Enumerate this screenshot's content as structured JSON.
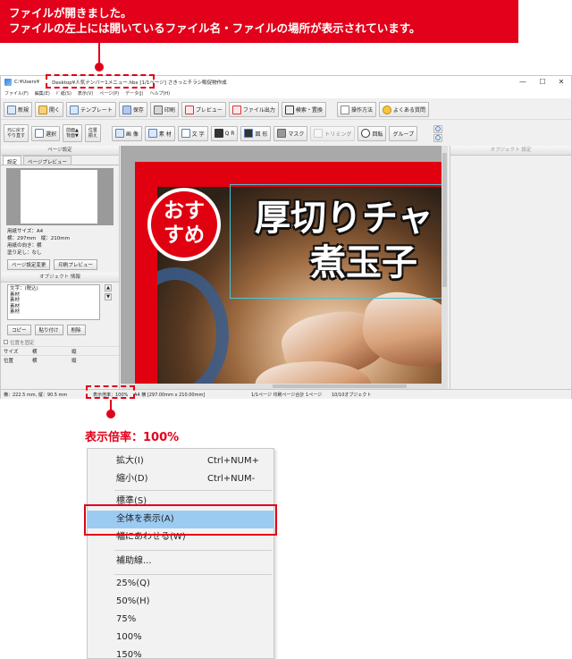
{
  "callout": {
    "line1": "ファイルが開きました。",
    "line2": "ファイルの左上には開いているファイル名・ファイルの場所が表示されています。"
  },
  "window": {
    "title_path": "C:¥Users¥",
    "title_file": "Desktop¥人気ナンバー1メニュー.hbs",
    "title_page": "[1/1ページ]",
    "title_app": "さきっとチラシ販促物作成",
    "minimize": "—",
    "maximize": "☐",
    "close": "✕"
  },
  "menubar": [
    "ファイル(F)",
    "編集(E)",
    "ﾄﾞ紙(S)",
    "表示(V)",
    "ページ(P)",
    "データ(J)",
    "ヘルプ(H)"
  ],
  "toolbar1": {
    "new": "新規",
    "open": "開く",
    "template": "テンプレート",
    "save": "保存",
    "print": "印刷",
    "preview": "プレビュー",
    "file_output": "ファイル出力",
    "search_replace": "検索・置換",
    "manual": "操作方法",
    "faq": "よくある質問"
  },
  "toolbar2": {
    "undo": "元に戻す",
    "redo": "やり直す",
    "select": "選択",
    "front": "前面▲",
    "back": "背面▼",
    "align1": "位置",
    "align2": "揃え",
    "image": "画 像",
    "material": "素 材",
    "text": "文 字",
    "qr": "Q R",
    "shape": "図 形",
    "mask": "マスク",
    "trim": "トリミング",
    "rotate": "回転",
    "group": "グループ"
  },
  "left_panel": {
    "page_settings_header": "ページ設定",
    "tab_settings": "設定",
    "tab_preview": "ページプレビュー",
    "paper_size": "用紙サイズ：A4",
    "dimensions": "横：297mm　縦：210mm",
    "orientation": "用紙の向き：横",
    "bleed": "塗り足し：なし",
    "change_page_settings": "ページ設定変更",
    "print_preview": "印刷プレビュー",
    "object_info_header": "オブジェクト 情報",
    "object_list": [
      "文字：(税込)",
      "素材",
      "素材",
      "素材",
      "素材"
    ],
    "copy": "コピー",
    "paste": "貼り付け",
    "delete": "削除",
    "lock_position": "位置を固定",
    "size_label": "サイズ",
    "width_label": "横",
    "height_label": "縦",
    "position_label": "位置"
  },
  "canvas": {
    "stamp_text_line1": "おす",
    "stamp_text_line2": "すめ",
    "headline_line1": "厚切りチャ",
    "headline_line2": "煮玉子"
  },
  "right_panel": {
    "header": "オブジェクト 設定"
  },
  "statusbar": {
    "coords": "横：222.5 mm, 縦：90.5 mm",
    "zoom": "表示倍率：100%",
    "paper": "A4 横 [297.00mm x 210.00mm]",
    "pages": "1/1ページ 印刷ページ合計 1ページ",
    "objects": "10/10オブジェクト"
  },
  "zoom_callout": "表示倍率：100%",
  "context_menu": {
    "zoom_in": "拡大(I)",
    "zoom_in_shortcut": "Ctrl+NUM+",
    "zoom_out": "縮小(D)",
    "zoom_out_shortcut": "Ctrl+NUM-",
    "standard": "標準(S)",
    "fit_all": "全体を表示(A)",
    "fit_width": "幅にあわせる(W)",
    "guides": "補助線...",
    "z25": "25%(Q)",
    "z50": "50%(H)",
    "z75": "75%",
    "z100": "100%",
    "z150": "150%"
  },
  "colors": {
    "accent_red": "#e2001a",
    "highlight_blue": "#9ccbf2"
  }
}
